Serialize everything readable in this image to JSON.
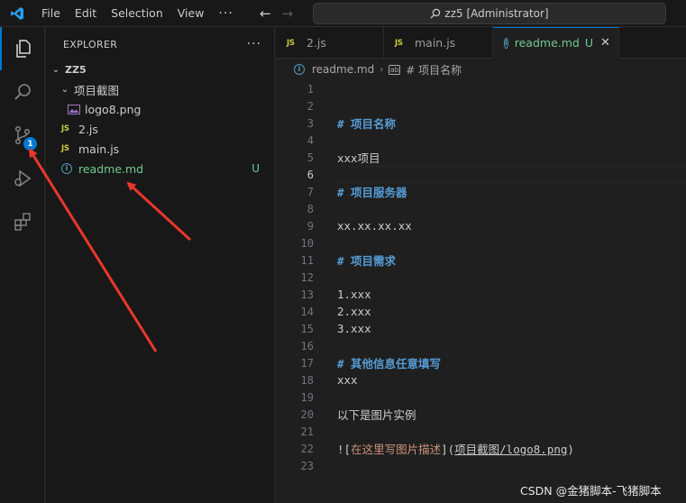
{
  "menu": {
    "file": "File",
    "edit": "Edit",
    "selection": "Selection",
    "view": "View",
    "more": "···"
  },
  "command_center": {
    "text": "zz5 [Administrator]"
  },
  "activity": {
    "scm_badge": "1"
  },
  "explorer": {
    "title": "EXPLORER",
    "more": "···",
    "root": "ZZ5",
    "items": [
      {
        "label": "项目截图",
        "kind": "folder"
      },
      {
        "label": "logo8.png",
        "kind": "image"
      },
      {
        "label": "2.js",
        "kind": "js",
        "icon": "JS"
      },
      {
        "label": "main.js",
        "kind": "js",
        "icon": "JS"
      },
      {
        "label": "readme.md",
        "kind": "markdown",
        "status": "U"
      }
    ]
  },
  "tabs": [
    {
      "label": "2.js",
      "icon": "JS"
    },
    {
      "label": "main.js",
      "icon": "JS"
    },
    {
      "label": "readme.md",
      "status": "U",
      "close": "✕"
    }
  ],
  "breadcrumb": {
    "file": "readme.md",
    "section": "# 项目名称"
  },
  "editor": {
    "current_line": 6,
    "lines": [
      {
        "n": "1",
        "text": ""
      },
      {
        "n": "2",
        "text": ""
      },
      {
        "n": "3",
        "text": "# 项目名称",
        "type": "heading"
      },
      {
        "n": "4",
        "text": ""
      },
      {
        "n": "5",
        "text": "xxx项目"
      },
      {
        "n": "6",
        "text": ""
      },
      {
        "n": "7",
        "text": "# 项目服务器",
        "type": "heading"
      },
      {
        "n": "8",
        "text": ""
      },
      {
        "n": "9",
        "text": "xx.xx.xx.xx"
      },
      {
        "n": "10",
        "text": ""
      },
      {
        "n": "11",
        "text": "# 项目需求",
        "type": "heading"
      },
      {
        "n": "12",
        "text": ""
      },
      {
        "n": "13",
        "text": "1.xxx"
      },
      {
        "n": "14",
        "text": "2.xxx"
      },
      {
        "n": "15",
        "text": "3.xxx"
      },
      {
        "n": "16",
        "text": ""
      },
      {
        "n": "17",
        "text": "# 其他信息任意填写",
        "type": "heading"
      },
      {
        "n": "18",
        "text": "xxx"
      },
      {
        "n": "19",
        "text": ""
      },
      {
        "n": "20",
        "text": "以下是图片实例"
      },
      {
        "n": "21",
        "text": ""
      },
      {
        "n": "22",
        "text": "",
        "type": "image-link",
        "link_open": "![",
        "link_text": "在这里写图片描述",
        "link_mid": "](",
        "link_url": "项目截图/logo8.png",
        "link_close": ")"
      },
      {
        "n": "23",
        "text": ""
      }
    ]
  },
  "watermark": "CSDN @金猪脚本-飞猪脚本",
  "colors": {
    "accent": "#0078d4",
    "untracked": "#73c991",
    "heading": "#569cd6",
    "annotation_arrow": "#e8372c"
  }
}
